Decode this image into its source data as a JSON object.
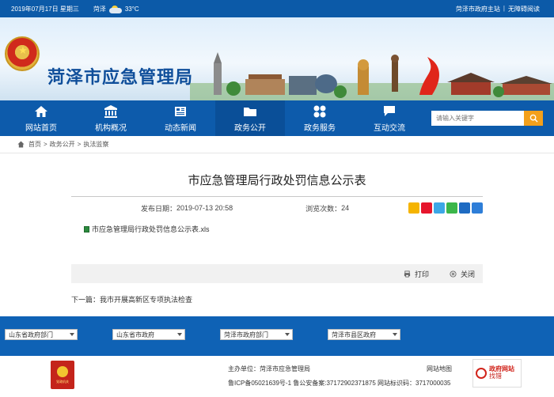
{
  "topbar": {
    "date": "2019年07月17日 星期三",
    "weather_city": "菏泽",
    "temperature": "33°C",
    "link_gov": "菏泽市政府主站",
    "separator": "|",
    "link_accessible": "无障碍阅读"
  },
  "header": {
    "site_name": "菏泽市应急管理局"
  },
  "nav": {
    "items": [
      {
        "label": "网站首页",
        "icon": "home-icon"
      },
      {
        "label": "机构概况",
        "icon": "building-icon"
      },
      {
        "label": "动态新闻",
        "icon": "news-icon"
      },
      {
        "label": "政务公开",
        "icon": "folder-icon"
      },
      {
        "label": "政务服务",
        "icon": "service-icon"
      },
      {
        "label": "互动交流",
        "icon": "chat-icon"
      }
    ],
    "search_placeholder": "请输入关键字"
  },
  "breadcrumb": {
    "home": "首页",
    "sep": ">",
    "level1": "政务公开",
    "level2": "执法监察"
  },
  "article": {
    "title": "市应急管理局行政处罚信息公示表",
    "publish_label": "发布日期：",
    "publish_date": "2019-07-13 20:58",
    "views_label": "浏览次数：",
    "views": "24",
    "attachment": "市应急管理局行政处罚信息公示表.xls",
    "print_label": "打印",
    "close_label": "关闭",
    "next_label": "下一篇：",
    "next_title": "我市开展高新区专项执法检查"
  },
  "share_icons": [
    {
      "name": "qzone-icon",
      "color": "#f5b400"
    },
    {
      "name": "weibo-icon",
      "color": "#e6162d"
    },
    {
      "name": "tencent-weibo-icon",
      "color": "#3da7e6"
    },
    {
      "name": "wechat-icon",
      "color": "#3bb64a"
    },
    {
      "name": "renren-icon",
      "color": "#1e6bc2"
    },
    {
      "name": "more-share-icon",
      "color": "#2e7ed8"
    }
  ],
  "links": {
    "select1": "山东省政府部门",
    "select2": "山东省市政府",
    "select3": "菏泽市政府部门",
    "select4": "菏泽市县区政府"
  },
  "footer": {
    "host_label": "主办单位：",
    "host": "菏泽市应急管理局",
    "icp": "鲁ICP备05021639号-1 鲁公安备案:37172902371875 网站标识码：3717000035",
    "sitemap": "网站地图",
    "gov_badge_line1": "政府网站",
    "gov_badge_line2": "找错",
    "party_label": "党政机关"
  },
  "colors": {
    "primary": "#0d5bab",
    "search_button": "#f3a01b",
    "title": "#0f4e9a"
  }
}
